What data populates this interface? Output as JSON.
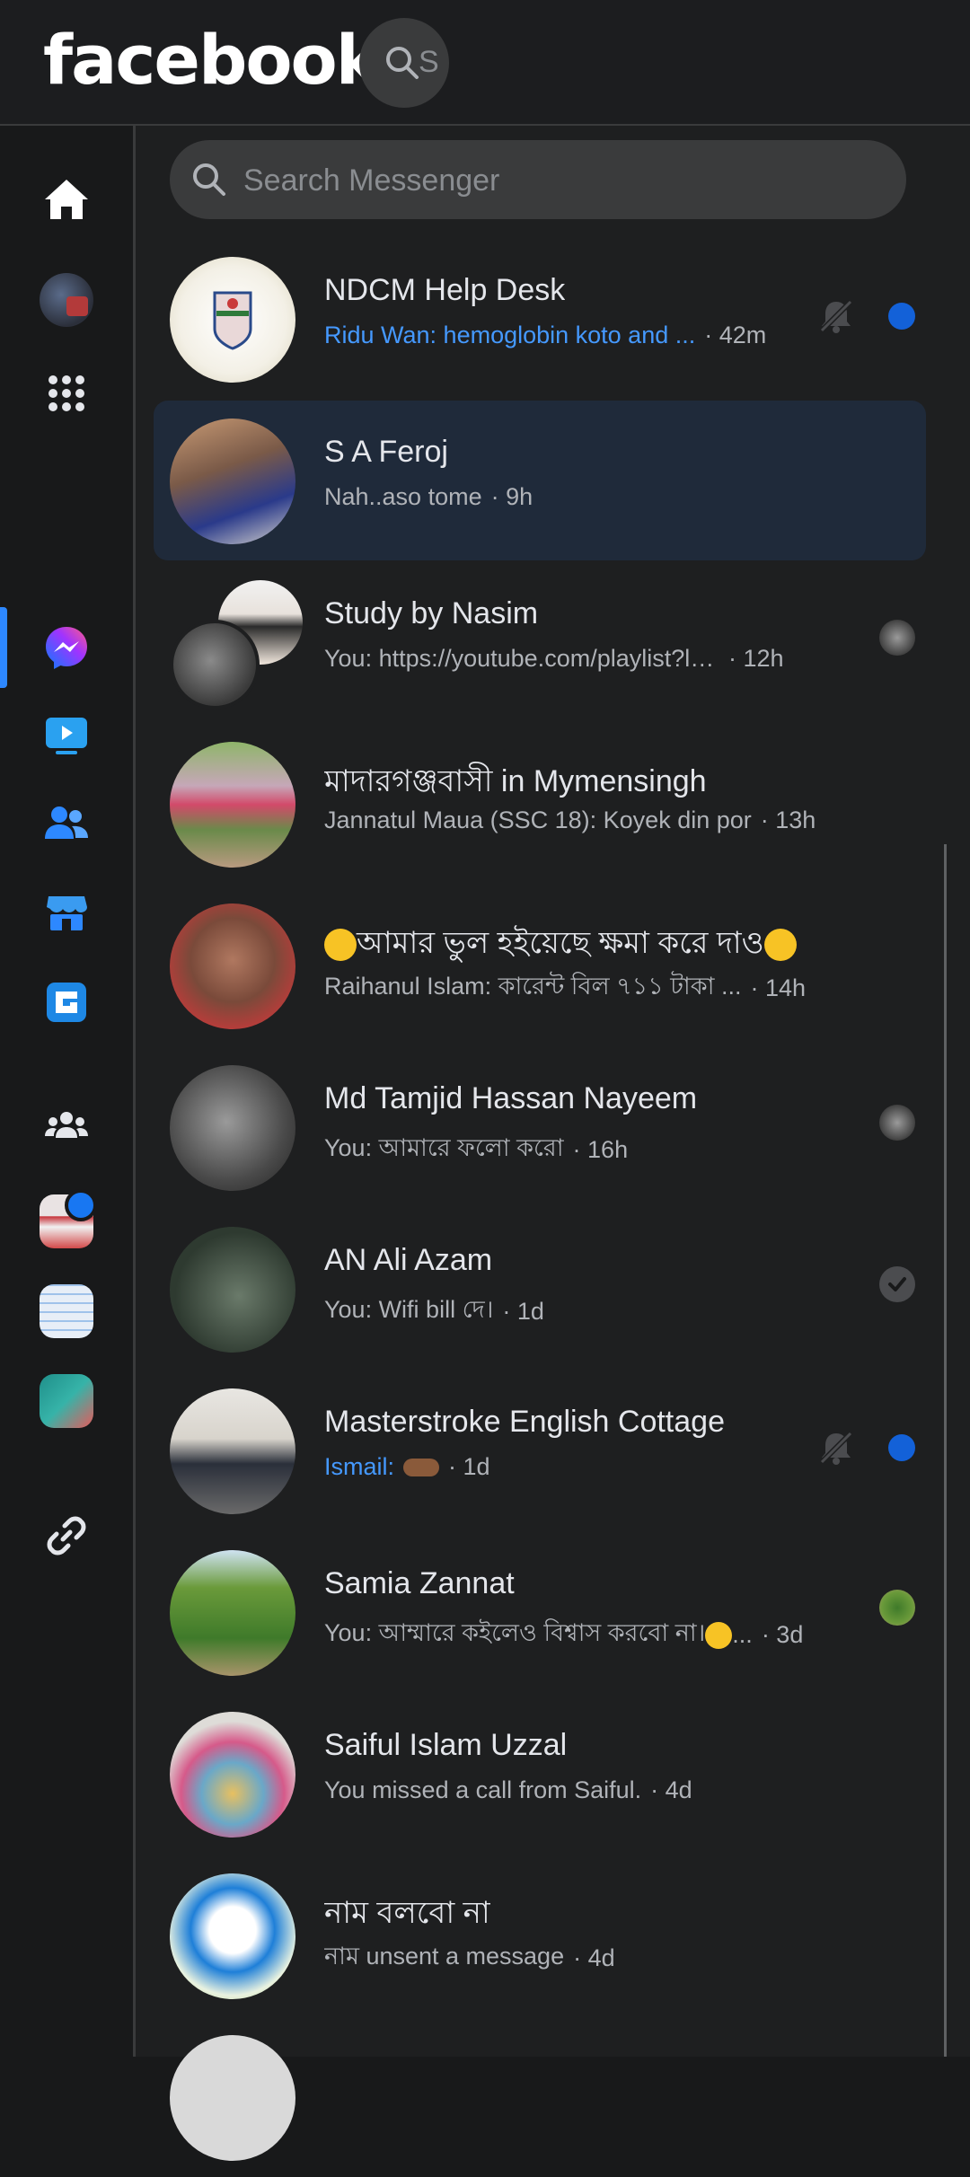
{
  "header": {
    "logo": "facebook",
    "search_glyph": "S"
  },
  "sidebar": {
    "items": [
      {
        "name": "home"
      },
      {
        "name": "profile"
      },
      {
        "name": "menu"
      },
      {
        "name": "messenger",
        "active": true
      },
      {
        "name": "watch"
      },
      {
        "name": "friends"
      },
      {
        "name": "marketplace"
      },
      {
        "name": "gaming"
      },
      {
        "name": "groups"
      },
      {
        "name": "shortcut-1",
        "notification": true
      },
      {
        "name": "shortcut-2"
      },
      {
        "name": "shortcut-3"
      },
      {
        "name": "link"
      }
    ]
  },
  "search": {
    "placeholder": "Search Messenger"
  },
  "chats": [
    {
      "name": "NDCM Help Desk",
      "preview": "Ridu Wan: hemoglobin koto and ...",
      "time": "· 42m",
      "unread": true,
      "muted": true
    },
    {
      "name": "S A Feroj",
      "preview": "Nah..aso tome",
      "time": "· 9h",
      "selected": true
    },
    {
      "name": "Study by Nasim",
      "preview": "You: https://youtube.com/playlist?list...",
      "time": "· 12h"
    },
    {
      "name": "মাদারগঞ্জবাসী in Mymensingh",
      "preview": "Jannatul Maua (SSC 18): Koyek din por",
      "time": "· 13h"
    },
    {
      "name": "আমার ভুল হইয়েছে ক্ষমা করে দাও",
      "preview": "Raihanul Islam: কারেন্ট বিল ৭১১ টাকা ...",
      "time": "· 14h"
    },
    {
      "name": "Md Tamjid Hassan Nayeem",
      "preview": "You: আমারে ফলো করো",
      "time": "· 16h"
    },
    {
      "name": "AN Ali Azam",
      "preview": "You: Wifi bill দে।",
      "time": "· 1d"
    },
    {
      "name": "Masterstroke English Cottage",
      "preview": "Ismail:",
      "time": "· 1d",
      "unread": true,
      "muted": true
    },
    {
      "name": "Samia Zannat",
      "preview": "You: আম্মারে কইলেও বিশ্বাস করবো না।",
      "preview_suffix": "...",
      "time": "· 3d"
    },
    {
      "name": "Saiful Islam Uzzal",
      "preview": "You missed a call from Saiful.",
      "time": "· 4d"
    },
    {
      "name": "নাম বলবো না",
      "preview": "নাম unsent a message",
      "time": "· 4d"
    }
  ],
  "colors": {
    "background": "#18191a",
    "accent": "#2d88ff",
    "unread_dot": "#1361d8",
    "unread_text": "#4599ff",
    "selected_row": "#1f2a3a"
  }
}
